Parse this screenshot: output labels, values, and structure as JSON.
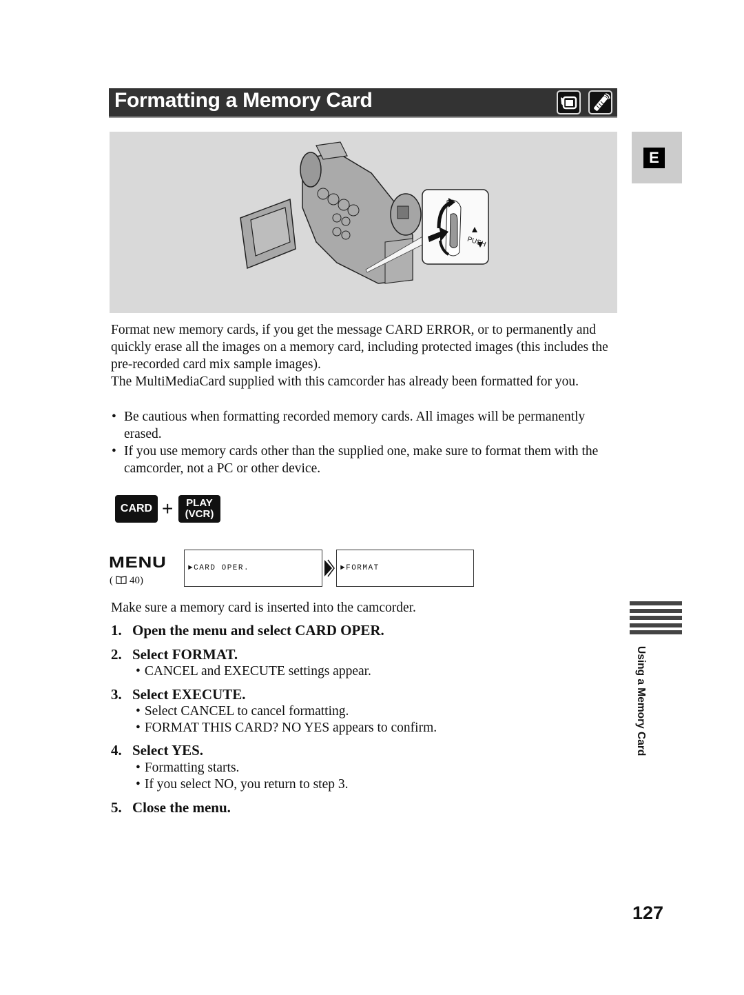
{
  "header": {
    "title": "Formatting a Memory Card",
    "icons": [
      "camcorder-icon",
      "remote-control-icon"
    ]
  },
  "language_tab": "E",
  "figure": {
    "description": "camcorder-with-lcd-open-and-push-dial-illustration",
    "callout_label": "PUSH"
  },
  "intro": {
    "paragraph1": "Format new memory cards, if you get the message CARD ERROR, or to permanently and quickly erase all the images on a memory card, including protected images (this includes the pre-recorded card mix sample images).",
    "paragraph2": "The MultiMediaCard supplied with this camcorder has already been formatted for you.",
    "bullets": [
      "Be cautious when formatting recorded memory cards. All images will be permanently erased.",
      "If you use memory cards other than the supplied one, make sure to format them with the camcorder, not a PC or other device."
    ]
  },
  "mode_keys": {
    "card": "CARD",
    "plus": "+",
    "play_line1": "PLAY",
    "play_line2": "(VCR)"
  },
  "menu": {
    "label": "MENU",
    "ref_open": "(",
    "ref_page": "40)",
    "path": [
      "►CARD OPER.",
      "►FORMAT"
    ]
  },
  "instructions": {
    "precondition": "Make sure a memory card is inserted into the camcorder.",
    "steps": [
      {
        "num": "1.",
        "text": "Open the menu and select CARD OPER.",
        "notes": []
      },
      {
        "num": "2.",
        "text": "Select FORMAT.",
        "notes": [
          "CANCEL and EXECUTE settings appear."
        ]
      },
      {
        "num": "3.",
        "text": "Select EXECUTE.",
        "notes": [
          "Select CANCEL to cancel formatting.",
          "FORMAT THIS CARD? NO YES appears to confirm."
        ]
      },
      {
        "num": "4.",
        "text": "Select YES.",
        "notes": [
          "Formatting starts.",
          "If you select NO, you return to step 3."
        ]
      },
      {
        "num": "5.",
        "text": "Close the menu.",
        "notes": []
      }
    ]
  },
  "side_section": "Using a Memory Card",
  "page_number": "127"
}
